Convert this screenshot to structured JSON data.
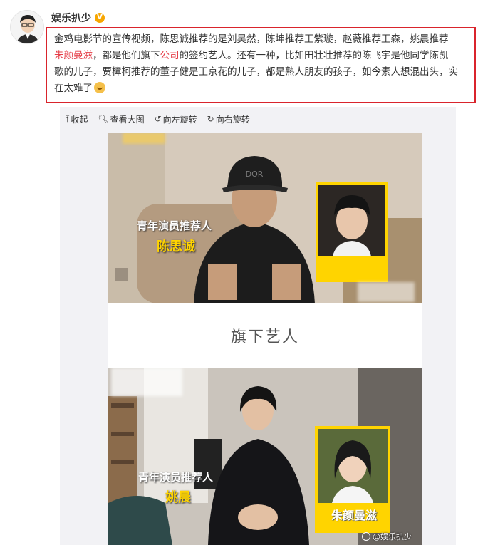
{
  "user": {
    "name": "娱乐扒少",
    "verified_badge": "V"
  },
  "post": {
    "line1_a": "金鸡电影节的宣传视频，陈思诚推荐的是刘昊然，陈坤推荐王紫璇，赵薇推荐王森，姚晨推荐",
    "line2_hl1": "朱颜曼滋",
    "line2_a": "，都是他们旗下",
    "line2_hl2": "公司",
    "line2_b": "的签约艺人。还有一种，比如田壮壮推荐的陈飞宇是他同学陈凯",
    "line3": "歌的儿子，贾樟柯推荐的董子健是王京花的儿子，都是熟人朋友的孩子，如今素人想混出头，实",
    "line4": "在太难了",
    "highlight_color": "#e53b45",
    "border_color": "#d9242c"
  },
  "toolbar": {
    "collapse": "收起",
    "view_large": "查看大图",
    "rotate_left": "向左旋转",
    "rotate_right": "向右旋转"
  },
  "image": {
    "panel1_caption_top": "青年演员推荐人",
    "panel1_caption_name": "陈思诚",
    "panel1_middle_label": "旗下艺人",
    "panel2_caption_top": "青年演员推荐人",
    "panel2_caption_name": "姚晨",
    "panel2_card_name": "朱颜曼滋",
    "watermark": "@娱乐扒少"
  }
}
